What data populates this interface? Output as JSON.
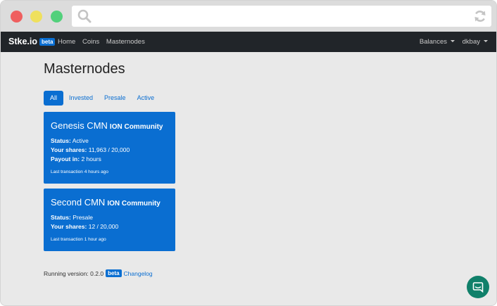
{
  "navbar": {
    "brand": "Stke.io",
    "brand_badge": "beta",
    "links": [
      "Home",
      "Coins",
      "Masternodes"
    ],
    "balances": "Balances",
    "user": "dkbay"
  },
  "page": {
    "title": "Masternodes",
    "tabs": [
      "All",
      "Invested",
      "Presale",
      "Active"
    ],
    "active_tab": "All"
  },
  "cards": [
    {
      "title": "Genesis CMN",
      "community": "ION Community",
      "status_label": "Status:",
      "status": "Active",
      "shares_label": "Your shares:",
      "shares": "11,963 / 20,000",
      "payout_label": "Payout in:",
      "payout": "2 hours",
      "last_tx": "Last transaction 4 hours ago"
    },
    {
      "title": "Second CMN",
      "community": "ION Community",
      "status_label": "Status:",
      "status": "Presale",
      "shares_label": "Your shares:",
      "shares": "12 / 20,000",
      "last_tx": "Last transaction 1 hour ago"
    }
  ],
  "footer": {
    "version_text": "Running version: 0.2.0",
    "badge": "beta",
    "changelog": "Changelog"
  },
  "icons": {
    "search": "search-icon",
    "reload": "reload-icon",
    "chat": "chat-icon"
  },
  "colors": {
    "primary": "#0a6ed1",
    "navbar": "#212529",
    "chat": "#10806a"
  }
}
